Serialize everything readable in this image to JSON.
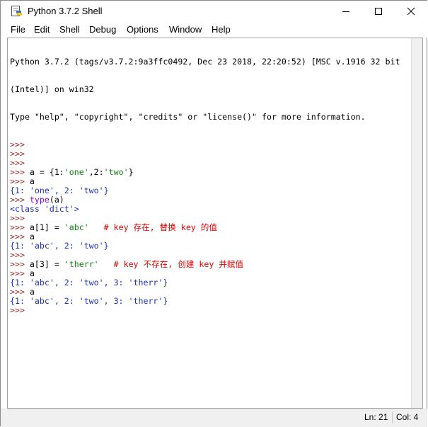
{
  "window": {
    "title": "Python 3.7.2 Shell"
  },
  "menu": [
    "File",
    "Edit",
    "Shell",
    "Debug",
    "Options",
    "Window",
    "Help"
  ],
  "shell": {
    "header": [
      "Python 3.7.2 (tags/v3.7.2:9a3ffc0492, Dec 23 2018, 22:20:52) [MSC v.1916 32 bit",
      "(Intel)] on win32",
      "Type \"help\", \"copyright\", \"credits\" or \"license()\" for more information."
    ],
    "prompt": ">>>",
    "lines": [
      [
        {
          "t": ">>> ",
          "c": "p"
        }
      ],
      [
        {
          "t": ">>> ",
          "c": "p"
        }
      ],
      [
        {
          "t": ">>> ",
          "c": "p"
        }
      ],
      [
        {
          "t": ">>> ",
          "c": "p"
        },
        {
          "t": "a = {1:",
          "c": ""
        },
        {
          "t": "'one'",
          "c": "s"
        },
        {
          "t": ",2:",
          "c": ""
        },
        {
          "t": "'two'",
          "c": "s"
        },
        {
          "t": "}",
          "c": ""
        }
      ],
      [
        {
          "t": ">>> ",
          "c": "p"
        },
        {
          "t": "a",
          "c": ""
        }
      ],
      [
        {
          "t": "{1: 'one', 2: 'two'}",
          "c": "o"
        }
      ],
      [
        {
          "t": ">>> ",
          "c": "p"
        },
        {
          "t": "type",
          "c": "k"
        },
        {
          "t": "(a)",
          "c": ""
        }
      ],
      [
        {
          "t": "<class 'dict'>",
          "c": "o"
        }
      ],
      [
        {
          "t": ">>> ",
          "c": "p"
        }
      ],
      [
        {
          "t": ">>> ",
          "c": "p"
        },
        {
          "t": "a[1] = ",
          "c": ""
        },
        {
          "t": "'abc'",
          "c": "s"
        },
        {
          "t": "   ",
          "c": ""
        },
        {
          "t": "# key 存在, 替换 key 的值",
          "c": "c"
        }
      ],
      [
        {
          "t": ">>> ",
          "c": "p"
        },
        {
          "t": "a",
          "c": ""
        }
      ],
      [
        {
          "t": "{1: 'abc', 2: 'two'}",
          "c": "o"
        }
      ],
      [
        {
          "t": ">>> ",
          "c": "p"
        }
      ],
      [
        {
          "t": ">>> ",
          "c": "p"
        },
        {
          "t": "a[3] = ",
          "c": ""
        },
        {
          "t": "'therr'",
          "c": "s"
        },
        {
          "t": "   ",
          "c": ""
        },
        {
          "t": "# key 不存在, 创建 key 并赋值",
          "c": "c"
        }
      ],
      [
        {
          "t": ">>> ",
          "c": "p"
        },
        {
          "t": "a",
          "c": ""
        }
      ],
      [
        {
          "t": "{1: 'abc', 2: 'two', 3: 'therr'}",
          "c": "o"
        }
      ],
      [
        {
          "t": ">>> ",
          "c": "p"
        },
        {
          "t": "a",
          "c": ""
        }
      ],
      [
        {
          "t": "{1: 'abc', 2: 'two', 3: 'therr'}",
          "c": "o"
        }
      ],
      [
        {
          "t": ">>> ",
          "c": "p"
        }
      ]
    ]
  },
  "status": {
    "line": "Ln: 21",
    "col": "Col: 4"
  },
  "icons": {
    "app": "python-idle-icon",
    "minimize": "minimize-icon",
    "maximize": "maximize-icon",
    "close": "close-icon"
  }
}
